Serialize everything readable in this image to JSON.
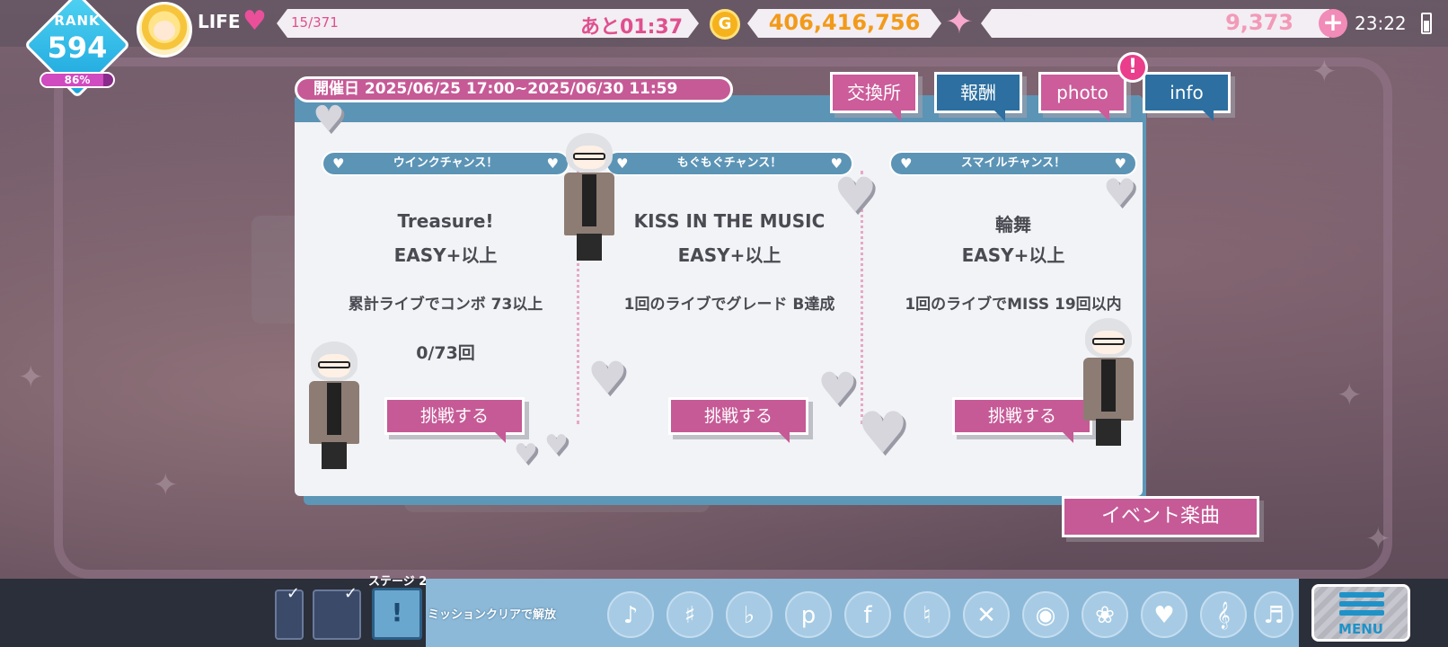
{
  "hud": {
    "rank_label": "RANK",
    "rank_value": "594",
    "rank_progress": "86%",
    "rank_progress_fraction": 0.86,
    "life_label": "LIFE",
    "life_count": "15/371",
    "life_timer": "あと01:37",
    "coin_symbol": "G",
    "coins": "406,416,756",
    "gems": "9,373",
    "clock": "23:22"
  },
  "event": {
    "period": "開催日 2025/06/25 17:00~2025/06/30 11:59",
    "buttons": {
      "exchange": "交換所",
      "reward": "報酬",
      "photo": "photo",
      "info": "info"
    },
    "photo_alert": "!",
    "event_song_button": "イベント楽曲"
  },
  "missions": [
    {
      "title": "ウインクチャンス！",
      "song": "Treasure!",
      "difficulty": "EASY+以上",
      "condition": "累計ライブでコンボ 73以上",
      "progress": "0/73回",
      "button": "挑戦する"
    },
    {
      "title": "もぐもぐチャンス！",
      "song": "KISS IN THE MUSIC",
      "difficulty": "EASY+以上",
      "condition": "1回のライブでグレード B達成",
      "progress": "",
      "button": "挑戦する"
    },
    {
      "title": "スマイルチャンス！",
      "song": "輪舞",
      "difficulty": "EASY+以上",
      "condition": "1回のライブでMISS 19回以内",
      "progress": "",
      "button": "挑戦する"
    }
  ],
  "bottom": {
    "stage_label": "ステージ 2",
    "stage_icon": "!",
    "unlock_text": "ミッションクリアで解放",
    "menu_label": "MENU"
  },
  "colors": {
    "pink": "#c65a96",
    "blue": "#5c94b6",
    "rank_blue": "#1aa4dc",
    "coin_orange": "#f29a1a"
  }
}
